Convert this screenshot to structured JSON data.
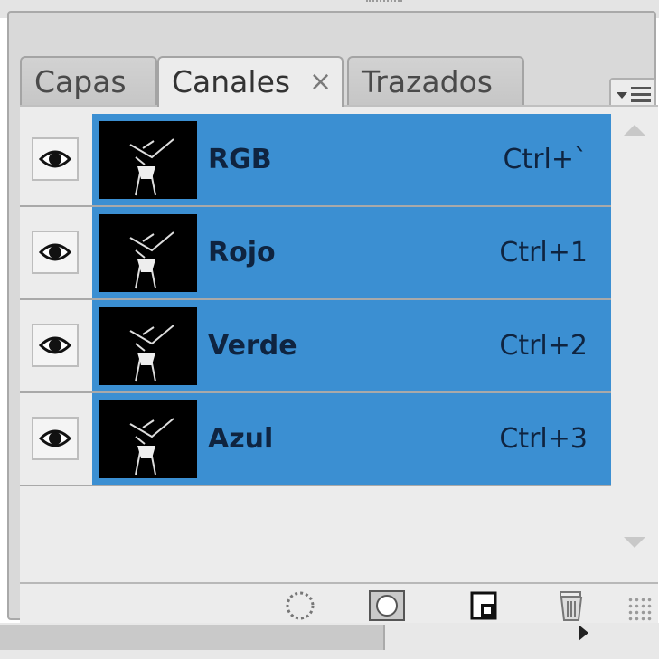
{
  "tabs": [
    {
      "label": "Capas",
      "active": false
    },
    {
      "label": "Canales",
      "active": true,
      "close": "×"
    },
    {
      "label": "Trazados",
      "active": false
    }
  ],
  "channels": [
    {
      "name": "RGB",
      "shortcut": "Ctrl+`"
    },
    {
      "name": "Rojo",
      "shortcut": "Ctrl+1"
    },
    {
      "name": "Verde",
      "shortcut": "Ctrl+2"
    },
    {
      "name": "Azul",
      "shortcut": "Ctrl+3"
    }
  ],
  "colors": {
    "selection": "#3b8fd2",
    "panel": "#ececec",
    "text": "#0f2440"
  },
  "footer_icons": [
    "load-selection-icon",
    "save-selection-mask-icon",
    "new-channel-icon",
    "trash-icon"
  ]
}
